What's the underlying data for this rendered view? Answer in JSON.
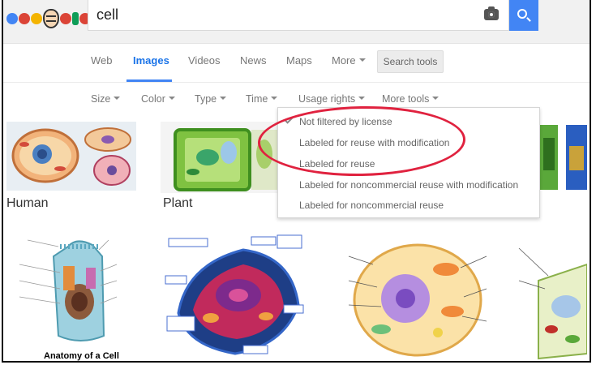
{
  "search": {
    "query": "cell"
  },
  "tabs": [
    {
      "label": "Web"
    },
    {
      "label": "Images"
    },
    {
      "label": "Videos"
    },
    {
      "label": "News"
    },
    {
      "label": "Maps"
    },
    {
      "label": "More"
    }
  ],
  "search_tools_label": "Search tools",
  "tools": [
    {
      "label": "Size"
    },
    {
      "label": "Color"
    },
    {
      "label": "Type"
    },
    {
      "label": "Time"
    },
    {
      "label": "Usage rights"
    },
    {
      "label": "More tools"
    }
  ],
  "usage_menu": {
    "items": [
      {
        "label": "Not filtered by license",
        "selected": true
      },
      {
        "label": "Labeled for reuse with modification"
      },
      {
        "label": "Labeled for reuse"
      },
      {
        "label": "Labeled for noncommercial reuse with modification"
      },
      {
        "label": "Labeled for noncommercial reuse"
      }
    ]
  },
  "captions": {
    "human": "Human",
    "plant": "Plant",
    "anatomy": "Anatomy of a Cell"
  },
  "colors": {
    "accent": "#4285f4",
    "active_tab": "#1a73e8",
    "annotation": "#e0223f"
  }
}
